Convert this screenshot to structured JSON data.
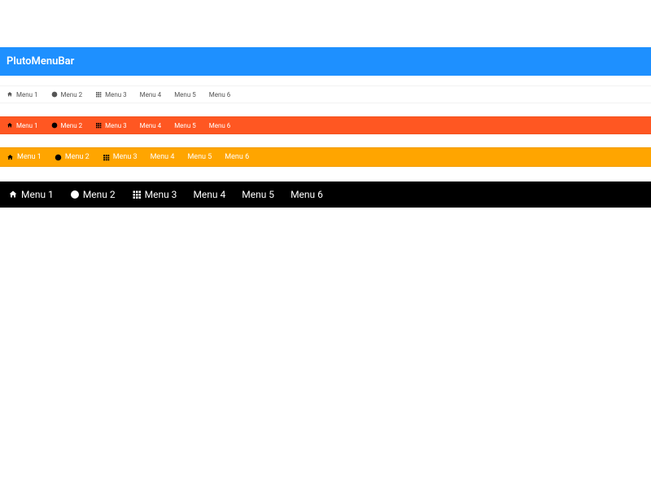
{
  "header": {
    "title": "PlutoMenuBar"
  },
  "menus": {
    "items": [
      {
        "label": "Menu 1",
        "icon": "home-icon"
      },
      {
        "label": "Menu 2",
        "icon": "add-circle-icon"
      },
      {
        "label": "Menu 3",
        "icon": "apps-grid-icon"
      },
      {
        "label": "Menu 4",
        "icon": null
      },
      {
        "label": "Menu 5",
        "icon": null
      },
      {
        "label": "Menu 6",
        "icon": null
      }
    ]
  },
  "bars": [
    {
      "variant": "white",
      "bg": "#ffffff",
      "text": "#555555",
      "iconColor": "#555555"
    },
    {
      "variant": "orange-red",
      "bg": "#ff5722",
      "text": "#ffffff",
      "iconColor": "#000000"
    },
    {
      "variant": "orange",
      "bg": "#ffa500",
      "text": "#ffffff",
      "iconColor": "#000000"
    },
    {
      "variant": "black",
      "bg": "#000000",
      "text": "#ffffff",
      "iconColor": "#ffffff"
    }
  ]
}
